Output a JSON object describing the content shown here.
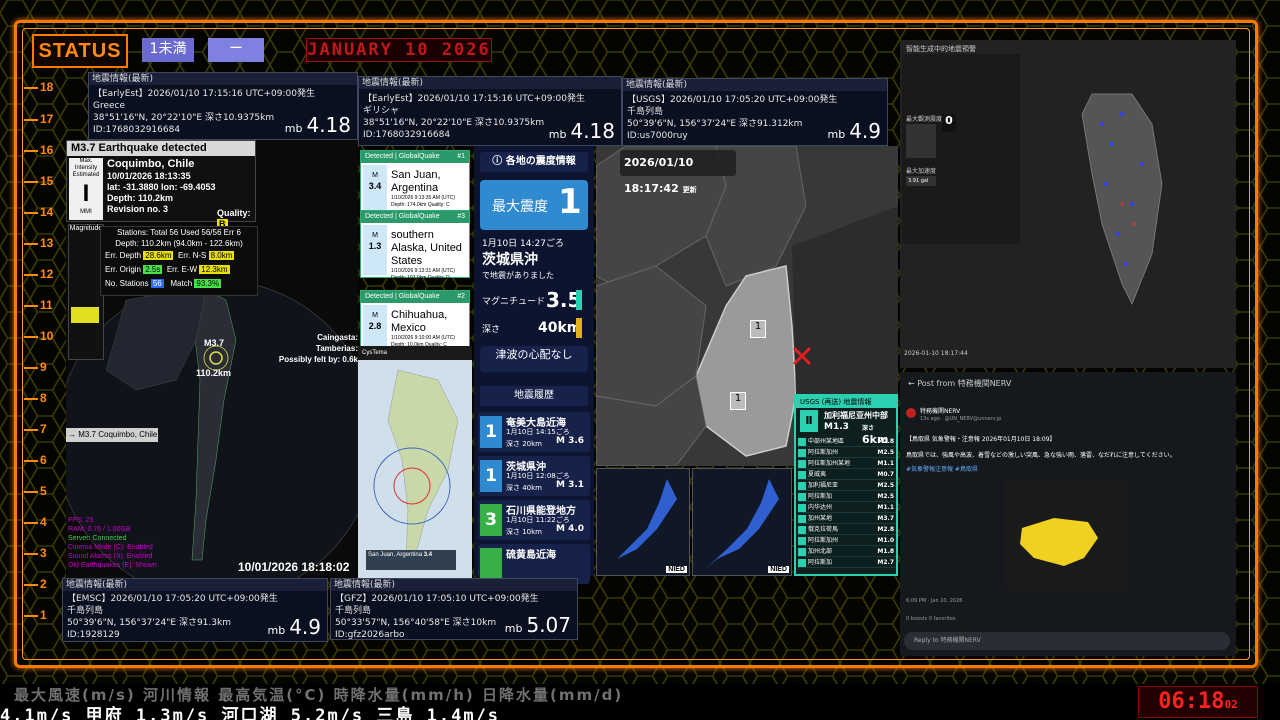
{
  "status": {
    "label": "STATUS",
    "chip1": "1未満",
    "chip2": "ー",
    "date": "JANUARY 10 2026"
  },
  "scale": [
    "18",
    "17",
    "16",
    "15",
    "14",
    "13",
    "12",
    "11",
    "10",
    "9",
    "8",
    "7",
    "6",
    "5",
    "4",
    "3",
    "2",
    "1"
  ],
  "quakes": {
    "top_left": {
      "header": "地震情報(最新)",
      "src": "【EarlyEst】2026/01/10 17:15:16 UTC+09:00発生",
      "place": "Greece",
      "coords": "38°51'16\"N, 20°22'10\"E 深さ10.9375km",
      "id": "ID:1768032916684",
      "mag_label": "mb",
      "mag": "4.18"
    },
    "top_mid": {
      "header": "地震情報(最新)",
      "src": "【EarlyEst】2026/01/10 17:15:16 UTC+09:00発生",
      "place": "ギリシャ",
      "coords": "38°51'16\"N, 20°22'10\"E 深さ10.9375km",
      "id": "ID:1768032916684",
      "mag_label": "mb",
      "mag": "4.18"
    },
    "top_right": {
      "header": "地震情報(最新)",
      "src": "【USGS】2026/01/10 17:05:20 UTC+09:00発生",
      "place": "千島列島",
      "coords": "50°39'6\"N, 156°37'24\"E 深さ91.312km",
      "id": "ID:us7000ruy",
      "mag_label": "mb",
      "mag": "4.9"
    },
    "bot_left": {
      "header": "地震情報(最新)",
      "src": "【EMSC】2026/01/10 17:05:20 UTC+09:00発生",
      "place": "千島列島",
      "coords": "50°39'6\"N, 156°37'24\"E 深さ91.3km",
      "id": "ID:1928129",
      "mag_label": "mb",
      "mag": "4.9"
    },
    "bot_mid": {
      "header": "地震情報(最新)",
      "src": "【GFZ】2026/01/10 17:05:10 UTC+09:00発生",
      "place": "千島列島",
      "coords": "50°33'57\"N, 156°40'58\"E 深さ10km",
      "id": "ID:gfz2026arbo",
      "mag_label": "mb",
      "mag": "5.07"
    }
  },
  "detect": {
    "title": "M3.7 Earthquake detected",
    "intensity_label": "Max. Intensity Estimated",
    "intensity": "I",
    "scale": "MMI",
    "place": "Coquimbo, Chile",
    "time": "10/01/2026 18:13:35",
    "lat": "lat: -31.3880 lon: -69.4053",
    "depth": "Depth: 110.2km",
    "revision": "Revision no. 3",
    "quality_label": "Quality:",
    "quality": "B",
    "magnitude_label": "Magnitude",
    "stations": "Stations: Total 56 Used 56/56 Err 6",
    "depth_range": "Depth: 110.2km (94.0km - 122.6km)",
    "err_depth_label": "Err. Depth",
    "err_depth": "28.6km",
    "err_ns_label": "Err. N-S",
    "err_ns": "8.0km",
    "err_origin_label": "Err. Origin",
    "err_origin": "2.5s",
    "err_ew_label": "Err. E-W",
    "err_ew": "12.3km",
    "nstations_label": "No. Stations",
    "nstations": "56",
    "match_label": "Match",
    "match": "93.3%",
    "map_label": "M3.7",
    "map_depth": "110.2km",
    "felt": "Caingasta:\nTamberias:\nPossibly felt by: 0.6k",
    "tag": "→ M3.7 Coquimbo, Chile",
    "fps": "FPS: 23",
    "ram": "RAM: 0.76 / 1.00GB",
    "server": "Server: Connected",
    "cinema": "Cinema Mode (C): Enabled",
    "sound": "Sound Alarms (S): Enabled",
    "old": "Old Earthquakes (E): Shown",
    "clock": "10/01/2026 18:18:02"
  },
  "globalquake": [
    {
      "tag": "Detected | GlobalQuake",
      "num": "#1",
      "mag": "3.4",
      "place": "San Juan, Argentina",
      "detail": "1/10/2026 9:13:35 AM (UTC)",
      "depth": "Depth: 174.0km",
      "quality": "Quality: C"
    },
    {
      "tag": "Detected | GlobalQuake",
      "num": "#3",
      "mag": "1.3",
      "place": "southern Alaska, United States",
      "detail": "1/10/2026 9:13:31 AM (UTC)",
      "depth": "Depth: 107.0km",
      "quality": "Quality: D"
    },
    {
      "tag": "Detected | GlobalQuake",
      "num": "#2",
      "mag": "2.8",
      "place": "Chihuahua, Mexico",
      "detail": "1/10/2026 9:10:00 AM (UTC)",
      "depth": "Depth: 10.0km",
      "quality": "Quality: C"
    }
  ],
  "jp_panel": {
    "title": "各地の震度情報",
    "max_label": "最大震度",
    "max_value": "1",
    "time": "1月10日 14:27ごろ",
    "region": "茨城県沖",
    "desc": "で地震がありました",
    "mag_label": "マグニチュード",
    "mag": "3.5",
    "depth_label": "深さ",
    "depth": "40km",
    "tsunami": "津波の心配なし",
    "history_title": "地震履歴",
    "history": [
      {
        "int": "1",
        "place": "奄美大島近海",
        "time": "1月10日 14:15ごろ",
        "depth": "深さ 20km",
        "mag": "M 3.6",
        "color": "#2f8ad0"
      },
      {
        "int": "1",
        "place": "茨城県沖",
        "time": "1月10日 12:08ごろ",
        "depth": "深さ 40km",
        "mag": "M 3.1",
        "color": "#2f8ad0"
      },
      {
        "int": "3",
        "place": "石川県能登地方",
        "time": "1月10日 11:22ごろ",
        "depth": "深さ 10km",
        "mag": "M 4.0",
        "color": "#38b048"
      },
      {
        "int": "",
        "place": "硫黄島近海",
        "time": "",
        "depth": "",
        "mag": "",
        "color": "#38b048"
      }
    ]
  },
  "cystema": {
    "label": "CysTema",
    "place": "San Juan, Argentina",
    "mag": "3.4"
  },
  "map": {
    "time": "2026/01/10 18:17:42",
    "update": "更新",
    "m1": "1",
    "m2": "1"
  },
  "usgs": {
    "title": "USGS (再送) 地震情報",
    "place": "加利福尼亚州中部",
    "mag": "M1.3",
    "depth_label": "深さ",
    "depth": "6km",
    "rows": [
      [
        "中部州某地區",
        "M2.8"
      ],
      [
        "阿拉斯加州",
        "M2.5"
      ],
      [
        "阿拉斯加州某地",
        "M1.1"
      ],
      [
        "夏威夷",
        "M0.7"
      ],
      [
        "加利福尼亚",
        "M2.5"
      ],
      [
        "阿拉斯加",
        "M2.5"
      ],
      [
        "内华达州",
        "M1.1"
      ],
      [
        "加州某地",
        "M3.7"
      ],
      [
        "俄克拉荷馬",
        "M2.8"
      ],
      [
        "阿拉斯加州",
        "M1.0"
      ],
      [
        "加州北部",
        "M1.8"
      ],
      [
        "阿拉斯加",
        "M2.7"
      ]
    ]
  },
  "nied": {
    "label": "NIED"
  },
  "taiwan": {
    "title": "智能生成中的地震預警",
    "max_label": "最大觀測震度",
    "max": "0",
    "level_label": "level",
    "trigger_label": "trigger",
    "stat1": "最遠",
    "stat2": "加速度",
    "stat3": "最大加速度",
    "gal": "3.91 gal",
    "time": "2026-01-10 18:17:44",
    "legend": [
      "7",
      "6",
      "5",
      "4",
      "3",
      "2",
      "1"
    ]
  },
  "nerv": {
    "header": "Post from 特務機関NERV",
    "author": "特務機関NERV",
    "handle": "13s ago · @UN_NERV@unnerv.jp",
    "body": "【鳥取県 気象警報・注意報 2026年01月10日 18:09】",
    "body2": "鳥取県では、強風や高波、着雪などの激しい突風、急な強い雨、落雷、なだれに注意してください。",
    "tags": "#気象警報注意報 #鳥取県",
    "time": "6:09 PM · Jan 10, 2026",
    "stats": "0 boosts   0 favorites",
    "reply": "Reply to 特務機関NERV"
  },
  "ticker": {
    "top": "最大風速(m/s)  河川情報    最高気温(°C)   時降水量(mm/h)  日降水量(mm/d)",
    "bottom": "4.1m/s   甲府 1.3m/s   河口湖 5.2m/s   三島 1.4m/s"
  },
  "clock": {
    "time": "06:18",
    "sec": "02"
  }
}
